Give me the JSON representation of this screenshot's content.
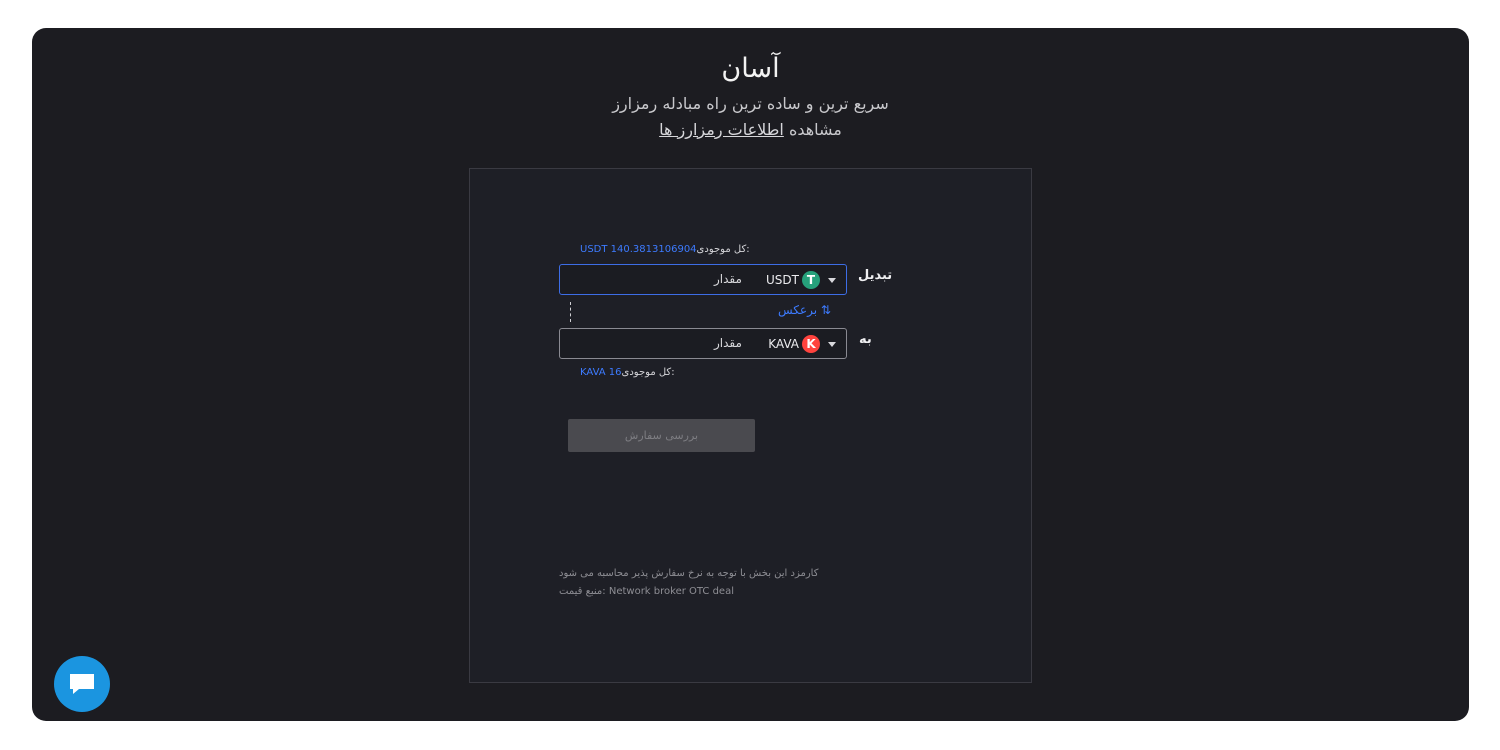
{
  "hero": {
    "title": "آسان",
    "subtitle": "سریع ترین و ساده ترین راه مبادله رمزارز",
    "link_prefix": "مشاهده",
    "link_text": "اطلاعات رمزارز ها"
  },
  "converter": {
    "from": {
      "label": "تبدیل",
      "balance_label": "کل موجودی:",
      "balance_value": "USDT 140.3813106904",
      "placeholder": "مقدار",
      "coin": "USDT",
      "coin_icon": "tether-icon",
      "coin_icon_color": "#26a17b",
      "coin_icon_glyph": "T"
    },
    "swap_label": "برعکس",
    "swap_glyph": "⇅",
    "to": {
      "label": "به",
      "balance_label": "کل موجودی:",
      "balance_value": "KAVA 16",
      "placeholder": "مقدار",
      "coin": "KAVA",
      "coin_icon": "kava-icon",
      "coin_icon_color": "#ff433e",
      "coin_icon_glyph": "K"
    },
    "submit_label": "بررسی سفارش",
    "fee_note": "کارمزد این بخش با توجه به نرخ سفارش پذیر محاسبه می شود",
    "price_source": "منبع قیمت: Network broker OTC deal"
  },
  "chat": {
    "icon": "chat-bubble-icon"
  },
  "colors": {
    "background": "#1c1c21",
    "accent": "#3d7bff",
    "chat": "#1b95e0"
  }
}
